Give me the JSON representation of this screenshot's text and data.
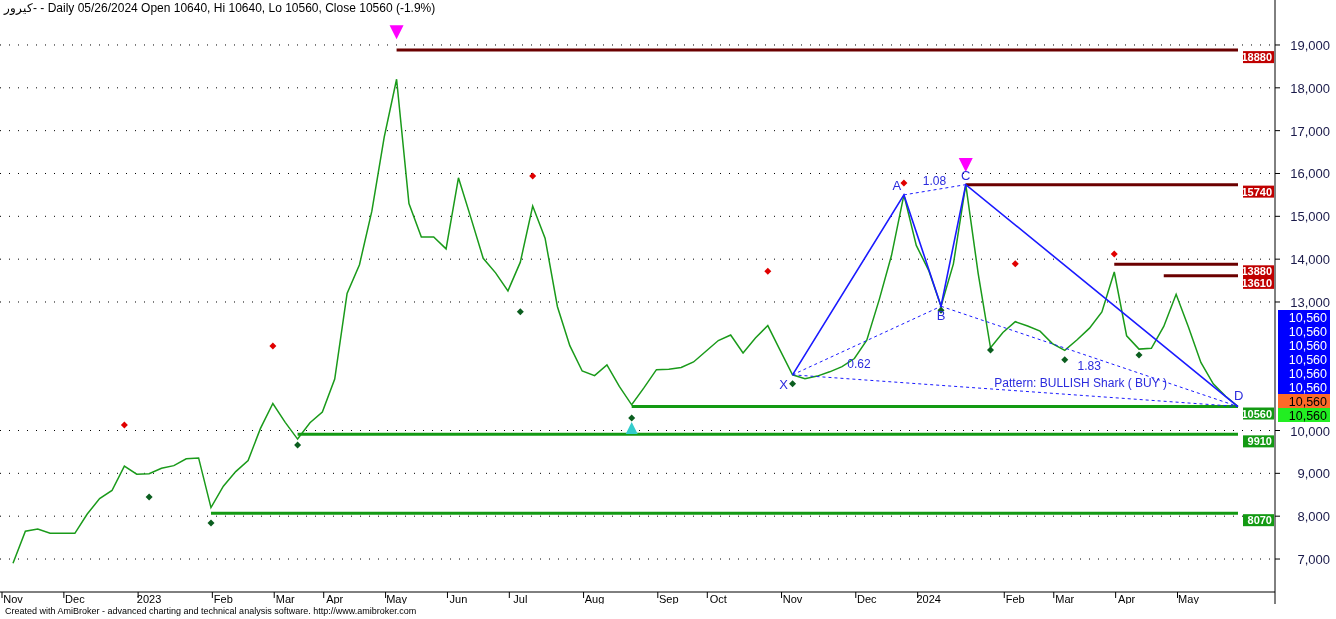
{
  "title": "کیرور- - Daily 05/26/2024 Open 10640, Hi 10640, Lo 10560, Close 10560 (-1.9%)",
  "chart": {
    "chart_data": {
      "type": "line",
      "grid": true,
      "ylim": [
        6230,
        20050
      ],
      "categories": [
        "Nov",
        null,
        null,
        null,
        null,
        "Dec",
        null,
        null,
        null,
        null,
        null,
        "2023",
        null,
        null,
        null,
        null,
        null,
        "Feb",
        null,
        null,
        null,
        null,
        "Mar",
        null,
        null,
        null,
        "Apr",
        null,
        null,
        null,
        null,
        "May",
        null,
        null,
        null,
        null,
        "Jun",
        null,
        null,
        null,
        null,
        "Jul",
        null,
        null,
        null,
        null,
        null,
        "Aug",
        null,
        null,
        null,
        null,
        null,
        "Sep",
        null,
        null,
        null,
        "Oct",
        null,
        null,
        null,
        null,
        null,
        "Nov",
        null,
        null,
        null,
        null,
        null,
        "Dec",
        null,
        null,
        null,
        null,
        "2024",
        null,
        null,
        null,
        null,
        null,
        null,
        "Feb",
        null,
        null,
        null,
        "Mar",
        null,
        null,
        null,
        null,
        "Apr",
        null,
        null,
        null,
        null,
        "May",
        null,
        null,
        null,
        null
      ],
      "series": [
        {
          "color": "#1a9a1a",
          "values": [
            6900,
            7650,
            7700,
            7600,
            7600,
            7600,
            8050,
            8410,
            8600,
            9170,
            8980,
            8990,
            9120,
            9180,
            9340,
            9360,
            8200,
            8700,
            9040,
            9300,
            10050,
            10630,
            10190,
            9800,
            10180,
            10430,
            11200,
            13200,
            13870,
            15120,
            16850,
            18200,
            15300,
            14520,
            14520,
            14240,
            15900,
            14970,
            14020,
            13680,
            13260,
            13930,
            15240,
            14490,
            12890,
            11980,
            11390,
            11280,
            11530,
            11030,
            10600,
            11000,
            11420,
            11430,
            11470,
            11600,
            11850,
            12100,
            12230,
            11810,
            12160,
            12450,
            11870,
            11300,
            11210,
            11270,
            11370,
            11490,
            11680,
            12110,
            13050,
            14090,
            15500,
            14320,
            13740,
            12900,
            13890,
            15740,
            13670,
            11930,
            12290,
            12540,
            12440,
            12320,
            12030,
            11870,
            12120,
            12390,
            12770,
            13700,
            12210,
            11900,
            11920,
            12430,
            13180,
            12410,
            11590,
            11090,
            10800,
            10560
          ]
        },
        {
          "name": "18880",
          "color": "#6b0000",
          "values": [
            null,
            null,
            null,
            null,
            null,
            null,
            null,
            null,
            null,
            null,
            null,
            null,
            null,
            null,
            null,
            null,
            null,
            null,
            null,
            null,
            null,
            null,
            null,
            null,
            null,
            null,
            null,
            null,
            null,
            null,
            null,
            18880,
            18880,
            18880,
            18880,
            18880,
            18880,
            18880,
            18880,
            18880,
            18880,
            18880,
            18880,
            18880,
            18880,
            18880,
            18880,
            18880,
            18880,
            18880,
            18880,
            18880,
            18880,
            18880,
            18880,
            18880,
            18880,
            18880,
            18880,
            18880,
            18880,
            18880,
            18880,
            18880,
            18880,
            18880,
            18880,
            18880,
            18880,
            18880,
            18880,
            18880,
            18880,
            18880,
            18880,
            18880,
            18880,
            18880,
            18880,
            18880,
            18880,
            18880,
            18880,
            18880,
            18880,
            18880,
            18880,
            18880,
            18880,
            18880,
            18880,
            18880,
            18880,
            18880,
            18880,
            18880,
            18880,
            18880,
            18880,
            18880
          ]
        },
        {
          "name": "15740",
          "color": "#6b0000",
          "values": [
            null,
            null,
            null,
            null,
            null,
            null,
            null,
            null,
            null,
            null,
            null,
            null,
            null,
            null,
            null,
            null,
            null,
            null,
            null,
            null,
            null,
            null,
            null,
            null,
            null,
            null,
            null,
            null,
            null,
            null,
            null,
            null,
            null,
            null,
            null,
            null,
            null,
            null,
            null,
            null,
            null,
            null,
            null,
            null,
            null,
            null,
            null,
            null,
            null,
            null,
            null,
            null,
            null,
            null,
            null,
            null,
            null,
            null,
            null,
            null,
            null,
            null,
            null,
            null,
            null,
            null,
            null,
            null,
            null,
            null,
            null,
            null,
            null,
            null,
            null,
            null,
            null,
            15740,
            15740,
            15740,
            15740,
            15740,
            15740,
            15740,
            15740,
            15740,
            15740,
            15740,
            15740,
            15740,
            15740,
            15740,
            15740,
            15740,
            15740,
            15740,
            15740,
            15740,
            15740,
            15740
          ]
        },
        {
          "name": "13880",
          "color": "#6b0000",
          "values": [
            null,
            null,
            null,
            null,
            null,
            null,
            null,
            null,
            null,
            null,
            null,
            null,
            null,
            null,
            null,
            null,
            null,
            null,
            null,
            null,
            null,
            null,
            null,
            null,
            null,
            null,
            null,
            null,
            null,
            null,
            null,
            null,
            null,
            null,
            null,
            null,
            null,
            null,
            null,
            null,
            null,
            null,
            null,
            null,
            null,
            null,
            null,
            null,
            null,
            null,
            null,
            null,
            null,
            null,
            null,
            null,
            null,
            null,
            null,
            null,
            null,
            null,
            null,
            null,
            null,
            null,
            null,
            null,
            null,
            null,
            null,
            null,
            null,
            null,
            null,
            null,
            null,
            null,
            null,
            null,
            null,
            null,
            null,
            null,
            null,
            null,
            null,
            null,
            null,
            13880,
            13880,
            13880,
            13880,
            13880,
            13880,
            13880,
            13880,
            13880,
            13880,
            13880
          ]
        },
        {
          "name": "13610",
          "color": "#6b0000",
          "values": [
            null,
            null,
            null,
            null,
            null,
            null,
            null,
            null,
            null,
            null,
            null,
            null,
            null,
            null,
            null,
            null,
            null,
            null,
            null,
            null,
            null,
            null,
            null,
            null,
            null,
            null,
            null,
            null,
            null,
            null,
            null,
            null,
            null,
            null,
            null,
            null,
            null,
            null,
            null,
            null,
            null,
            null,
            null,
            null,
            null,
            null,
            null,
            null,
            null,
            null,
            null,
            null,
            null,
            null,
            null,
            null,
            null,
            null,
            null,
            null,
            null,
            null,
            null,
            null,
            null,
            null,
            null,
            null,
            null,
            null,
            null,
            null,
            null,
            null,
            null,
            null,
            null,
            null,
            null,
            null,
            null,
            null,
            null,
            null,
            null,
            null,
            null,
            null,
            null,
            null,
            null,
            null,
            null,
            13610,
            13610,
            13610,
            13610,
            13610,
            13610,
            13610
          ]
        },
        {
          "name": "10560",
          "color": "#139a13",
          "values": [
            null,
            null,
            null,
            null,
            null,
            null,
            null,
            null,
            null,
            null,
            null,
            null,
            null,
            null,
            null,
            null,
            null,
            null,
            null,
            null,
            null,
            null,
            null,
            null,
            null,
            null,
            null,
            null,
            null,
            null,
            null,
            null,
            null,
            null,
            null,
            null,
            null,
            null,
            null,
            null,
            null,
            null,
            null,
            null,
            null,
            null,
            null,
            null,
            null,
            null,
            10560,
            10560,
            10560,
            10560,
            10560,
            10560,
            10560,
            10560,
            10560,
            10560,
            10560,
            10560,
            10560,
            10560,
            10560,
            10560,
            10560,
            10560,
            10560,
            10560,
            10560,
            10560,
            10560,
            10560,
            10560,
            10560,
            10560,
            10560,
            10560,
            10560,
            10560,
            10560,
            10560,
            10560,
            10560,
            10560,
            10560,
            10560,
            10560,
            10560,
            10560,
            10560,
            10560,
            10560,
            10560,
            10560,
            10560,
            10560,
            10560,
            10560
          ]
        },
        {
          "name": "9910",
          "color": "#139a13",
          "values": [
            null,
            null,
            null,
            null,
            null,
            null,
            null,
            null,
            null,
            null,
            null,
            null,
            null,
            null,
            null,
            null,
            null,
            null,
            null,
            null,
            null,
            null,
            null,
            9910,
            9910,
            9910,
            9910,
            9910,
            9910,
            9910,
            9910,
            9910,
            9910,
            9910,
            9910,
            9910,
            9910,
            9910,
            9910,
            9910,
            9910,
            9910,
            9910,
            9910,
            9910,
            9910,
            9910,
            9910,
            9910,
            9910,
            9910,
            9910,
            9910,
            9910,
            9910,
            9910,
            9910,
            9910,
            9910,
            9910,
            9910,
            9910,
            9910,
            9910,
            9910,
            9910,
            9910,
            9910,
            9910,
            9910,
            9910,
            9910,
            9910,
            9910,
            9910,
            9910,
            9910,
            9910,
            9910,
            9910,
            9910,
            9910,
            9910,
            9910,
            9910,
            9910,
            9910,
            9910,
            9910,
            9910,
            9910,
            9910,
            9910,
            9910,
            9910,
            9910,
            9910,
            9910,
            9910,
            9910
          ]
        },
        {
          "name": "8070",
          "color": "#139a13",
          "values": [
            null,
            null,
            null,
            null,
            null,
            null,
            null,
            null,
            null,
            null,
            null,
            null,
            null,
            null,
            null,
            null,
            8070,
            8070,
            8070,
            8070,
            8070,
            8070,
            8070,
            8070,
            8070,
            8070,
            8070,
            8070,
            8070,
            8070,
            8070,
            8070,
            8070,
            8070,
            8070,
            8070,
            8070,
            8070,
            8070,
            8070,
            8070,
            8070,
            8070,
            8070,
            8070,
            8070,
            8070,
            8070,
            8070,
            8070,
            8070,
            8070,
            8070,
            8070,
            8070,
            8070,
            8070,
            8070,
            8070,
            8070,
            8070,
            8070,
            8070,
            8070,
            8070,
            8070,
            8070,
            8070,
            8070,
            8070,
            8070,
            8070,
            8070,
            8070,
            8070,
            8070,
            8070,
            8070,
            8070,
            8070,
            8070,
            8070,
            8070,
            8070,
            8070,
            8070,
            8070,
            8070,
            8070,
            8070,
            8070,
            8070,
            8070,
            8070,
            8070,
            8070,
            8070,
            8070,
            8070,
            8070
          ]
        },
        {
          "color": "#1a1aff",
          "values": [
            null,
            null,
            null,
            null,
            null,
            null,
            null,
            null,
            null,
            null,
            null,
            null,
            null,
            null,
            null,
            null,
            null,
            null,
            null,
            null,
            null,
            null,
            null,
            null,
            null,
            null,
            null,
            null,
            null,
            null,
            null,
            null,
            null,
            null,
            null,
            null,
            null,
            null,
            null,
            null,
            null,
            null,
            null,
            null,
            null,
            null,
            null,
            null,
            null,
            null,
            null,
            null,
            null,
            null,
            null,
            null,
            null,
            null,
            null,
            null,
            null,
            null,
            null,
            11300,
            null,
            null,
            null,
            null,
            null,
            null,
            null,
            null,
            15500,
            null,
            null,
            12900,
            null,
            15740,
            null,
            null,
            null,
            null,
            null,
            null,
            null,
            null,
            null,
            null,
            null,
            null,
            null,
            null,
            null,
            null,
            null,
            null,
            null,
            null,
            null,
            10560
          ]
        },
        {
          "type": "scatter",
          "color": "#e00000",
          "values": [
            null,
            null,
            null,
            null,
            null,
            null,
            null,
            null,
            null,
            10130,
            null,
            null,
            null,
            null,
            null,
            null,
            null,
            null,
            null,
            null,
            null,
            11970,
            null,
            null,
            null,
            null,
            null,
            null,
            null,
            null,
            null,
            null,
            null,
            null,
            null,
            null,
            null,
            null,
            null,
            null,
            null,
            null,
            15940,
            null,
            null,
            null,
            null,
            null,
            null,
            null,
            null,
            null,
            null,
            null,
            null,
            null,
            null,
            null,
            null,
            null,
            null,
            13720,
            null,
            null,
            null,
            null,
            null,
            null,
            null,
            null,
            null,
            null,
            15780,
            null,
            null,
            null,
            null,
            null,
            null,
            null,
            null,
            13890,
            null,
            null,
            null,
            null,
            null,
            null,
            null,
            14120,
            null,
            null,
            null,
            null,
            null,
            null,
            null,
            null,
            null,
            null
          ]
        },
        {
          "type": "scatter",
          "color": "#0b5e1f",
          "values": [
            null,
            null,
            null,
            null,
            null,
            null,
            null,
            null,
            null,
            null,
            null,
            8450,
            null,
            null,
            null,
            null,
            7840,
            null,
            null,
            null,
            null,
            null,
            null,
            9660,
            null,
            null,
            null,
            null,
            null,
            null,
            null,
            null,
            null,
            null,
            null,
            null,
            null,
            null,
            null,
            null,
            null,
            12770,
            null,
            null,
            null,
            null,
            null,
            null,
            null,
            null,
            10290,
            null,
            null,
            null,
            null,
            null,
            null,
            null,
            null,
            null,
            null,
            null,
            null,
            11090,
            null,
            null,
            null,
            null,
            null,
            null,
            null,
            null,
            null,
            null,
            null,
            12810,
            null,
            null,
            null,
            11880,
            null,
            null,
            null,
            null,
            null,
            11650,
            null,
            null,
            null,
            null,
            null,
            11760,
            null,
            null,
            null,
            null,
            null,
            null,
            null,
            null
          ]
        },
        {
          "type": "scatter",
          "color": "#ff00ff",
          "values": [
            null,
            null,
            null,
            null,
            null,
            null,
            null,
            null,
            null,
            null,
            null,
            null,
            null,
            null,
            null,
            null,
            null,
            null,
            null,
            null,
            null,
            null,
            null,
            null,
            null,
            null,
            null,
            null,
            null,
            null,
            null,
            19300,
            null,
            null,
            null,
            null,
            null,
            null,
            null,
            null,
            null,
            null,
            null,
            null,
            null,
            null,
            null,
            null,
            null,
            null,
            null,
            null,
            null,
            null,
            null,
            null,
            null,
            null,
            null,
            null,
            null,
            null,
            null,
            null,
            null,
            null,
            null,
            null,
            null,
            null,
            null,
            null,
            null,
            null,
            null,
            null,
            null,
            16200,
            null,
            null,
            null,
            null,
            null,
            null,
            null,
            null,
            null,
            null,
            null,
            null,
            null,
            null,
            null,
            null,
            null,
            null,
            null,
            null,
            null,
            null
          ]
        },
        {
          "type": "scatter",
          "color": "#33cccc",
          "values": [
            null,
            null,
            null,
            null,
            null,
            null,
            null,
            null,
            null,
            null,
            null,
            null,
            null,
            null,
            null,
            null,
            null,
            null,
            null,
            null,
            null,
            null,
            null,
            null,
            null,
            null,
            null,
            null,
            null,
            null,
            null,
            null,
            null,
            null,
            null,
            null,
            null,
            null,
            null,
            null,
            null,
            null,
            null,
            null,
            null,
            null,
            null,
            null,
            null,
            null,
            10060,
            null,
            null,
            null,
            null,
            null,
            null,
            null,
            null,
            null,
            null,
            null,
            null,
            null,
            null,
            null,
            null,
            null,
            null,
            null,
            null,
            null,
            null,
            null,
            null,
            null,
            null,
            null,
            null,
            null,
            null,
            null,
            null,
            null,
            null,
            null,
            null,
            null,
            null,
            null,
            null,
            null,
            null,
            null,
            null,
            null,
            null,
            null,
            null,
            null
          ]
        }
      ],
      "yticks": [
        {
          "value": 7000,
          "label": "7,000"
        },
        {
          "value": 8000,
          "label": "8,000"
        },
        {
          "value": 9000,
          "label": "9,000"
        },
        {
          "value": 10000,
          "label": "10,000"
        },
        {
          "value": 13000,
          "label": "13,000"
        },
        {
          "value": 14000,
          "label": "14,000"
        },
        {
          "value": 15000,
          "label": "15,000"
        },
        {
          "value": 16000,
          "label": "16,000"
        },
        {
          "value": 17000,
          "label": "17,000"
        },
        {
          "value": 18000,
          "label": "18,000"
        },
        {
          "value": 19000,
          "label": "19,000"
        }
      ],
      "annotations": [
        "X",
        "A",
        "B",
        "C",
        "D",
        "1.08",
        "0.62",
        "1.83",
        "Pattern: BULLISH Shark ( BUY )"
      ]
    }
  },
  "price_labels": [
    {
      "text": "10,560",
      "color": "#0000ff"
    },
    {
      "text": "10,560",
      "color": "#0000ff"
    },
    {
      "text": "10,560",
      "color": "#0000ff"
    },
    {
      "text": "10,560",
      "color": "#0000ff"
    },
    {
      "text": "10,560",
      "color": "#0000ff"
    },
    {
      "text": "10,560",
      "color": "#0000ff"
    },
    {
      "text": "10,560",
      "color": "#ff6a28"
    },
    {
      "text": "10,560",
      "color": "#22ee22"
    }
  ],
  "footer": "Created with AmiBroker - advanced charting and technical analysis software. http://www.amibroker.com"
}
